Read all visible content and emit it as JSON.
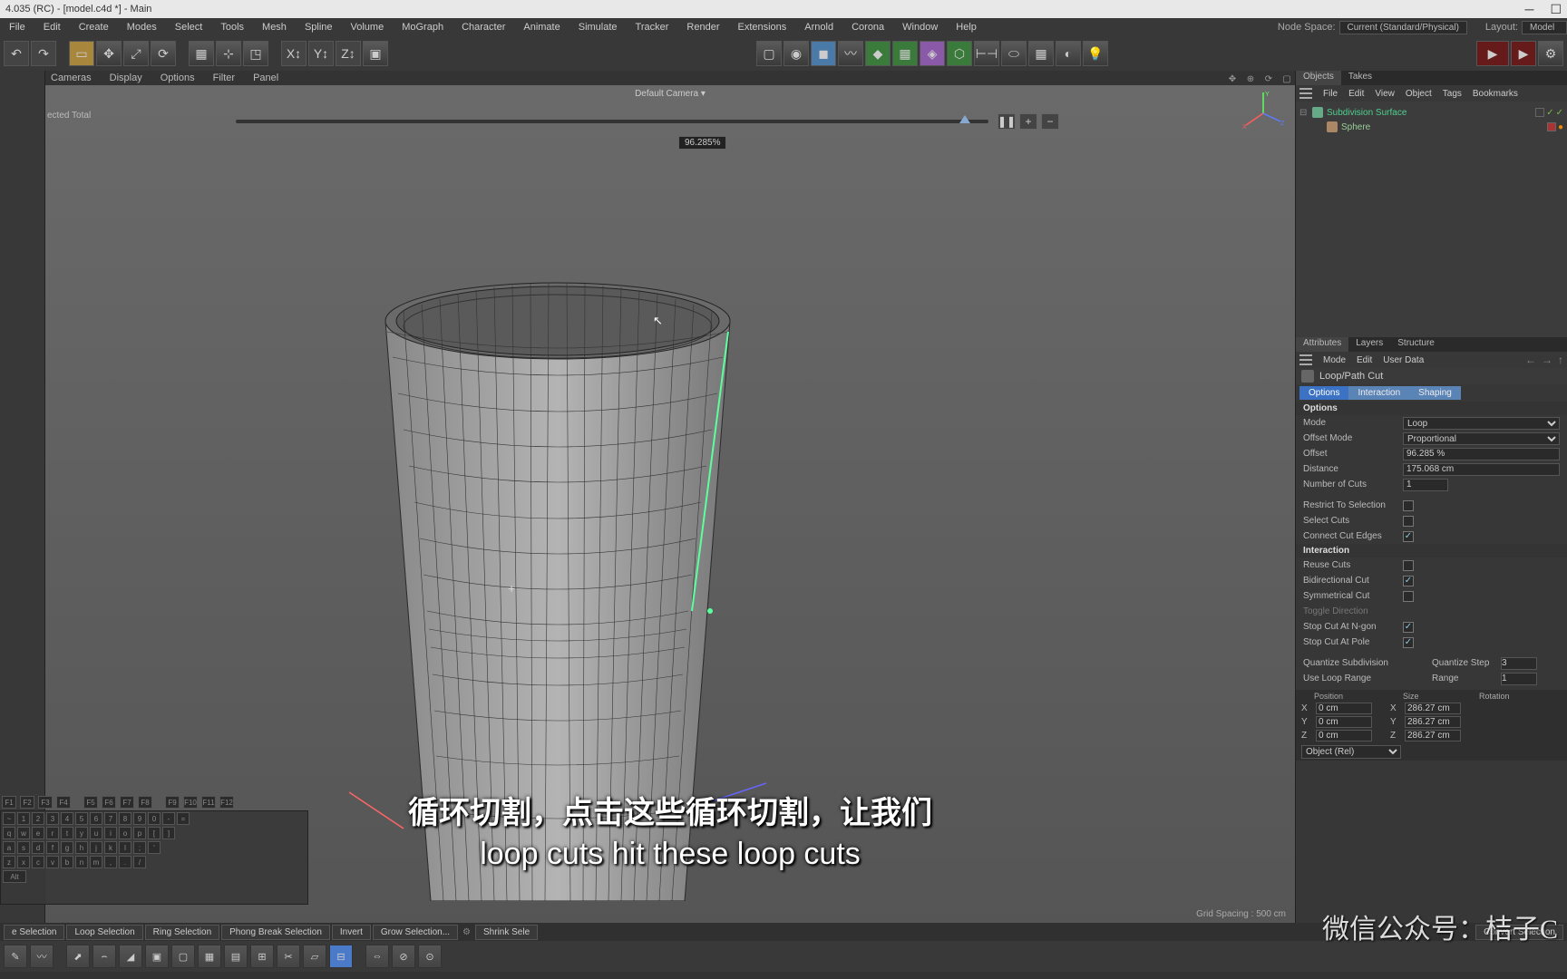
{
  "window": {
    "title": "4.035 (RC) - [model.c4d *] - Main"
  },
  "menu": {
    "items": [
      "File",
      "Edit",
      "Create",
      "Modes",
      "Select",
      "Tools",
      "Mesh",
      "Spline",
      "Volume",
      "MoGraph",
      "Character",
      "Animate",
      "Simulate",
      "Tracker",
      "Render",
      "Extensions",
      "Arnold",
      "Corona",
      "Window",
      "Help"
    ],
    "nodeSpaceLabel": "Node Space:",
    "nodeSpaceValue": "Current (Standard/Physical)",
    "layoutLabel": "Layout:",
    "layoutValue": "Model"
  },
  "viewport": {
    "tabs": [
      "Cameras",
      "Display",
      "Options",
      "Filter",
      "Panel"
    ],
    "camera": "Default Camera",
    "sliderPercent": "96.285%",
    "selectedLabel": "ected Total",
    "gridSpacing": "Grid Spacing : 500 cm",
    "sliderPos": 96.285
  },
  "objects": {
    "tabs": [
      "Objects",
      "Takes"
    ],
    "menu": [
      "File",
      "Edit",
      "View",
      "Object",
      "Tags",
      "Bookmarks"
    ],
    "tree": [
      {
        "name": "Subdivision Surface",
        "type": "sds",
        "level": 0
      },
      {
        "name": "Sphere",
        "type": "sphere",
        "level": 1
      }
    ]
  },
  "attributes": {
    "tabs": [
      "Attributes",
      "Layers",
      "Structure"
    ],
    "menu": [
      "Mode",
      "Edit",
      "User Data"
    ],
    "toolName": "Loop/Path Cut",
    "optTabs": [
      "Options",
      "Interaction",
      "Shaping"
    ],
    "sections": {
      "options": {
        "header": "Options",
        "mode": {
          "label": "Mode",
          "value": "Loop"
        },
        "offsetMode": {
          "label": "Offset Mode",
          "value": "Proportional"
        },
        "offset": {
          "label": "Offset",
          "value": "96.285 %"
        },
        "distance": {
          "label": "Distance",
          "value": "175.068 cm"
        },
        "cuts": {
          "label": "Number of Cuts",
          "value": "1"
        },
        "restrict": {
          "label": "Restrict To Selection",
          "value": false
        },
        "selectCuts": {
          "label": "Select Cuts",
          "value": false
        },
        "connect": {
          "label": "Connect Cut Edges",
          "value": true
        }
      },
      "interaction": {
        "header": "Interaction",
        "reuse": {
          "label": "Reuse Cuts",
          "value": false
        },
        "bidir": {
          "label": "Bidirectional Cut",
          "value": true
        },
        "sym": {
          "label": "Symmetrical Cut",
          "value": false
        },
        "toggle": {
          "label": "Toggle Direction"
        },
        "stopNgon": {
          "label": "Stop Cut At N-gon",
          "value": true
        },
        "stopPole": {
          "label": "Stop Cut At Pole",
          "value": true
        },
        "quantSub": {
          "label": "Quantize Subdivision",
          "value": false
        },
        "quantStep": {
          "label": "Quantize Step",
          "value": "3"
        },
        "useLoop": {
          "label": "Use Loop Range",
          "value": false
        },
        "range": {
          "label": "Range",
          "value": "1"
        }
      }
    },
    "coord": {
      "posHeader": "Position",
      "sizeHeader": "Size",
      "rotHeader": "Rotation",
      "xLabel": "X",
      "yLabel": "Y",
      "zLabel": "Z",
      "px": "0 cm",
      "py": "0 cm",
      "pz": "0 cm",
      "sx": "286.27 cm",
      "sy": "286.27 cm",
      "sz": "286.27 cm",
      "dropdown": "Object (Rel)"
    }
  },
  "lower": {
    "selButtons": [
      "e Selection",
      "Loop Selection",
      "Ring Selection",
      "Phong Break Selection",
      "Invert",
      "Grow Selection...",
      "Shrink Sele",
      "Convert Selection"
    ]
  },
  "subtitle": {
    "cn": "循环切割，点击这些循环切割，让我们",
    "en": "loop cuts hit these loop cuts"
  },
  "watermark": "微信公众号：桔子C"
}
